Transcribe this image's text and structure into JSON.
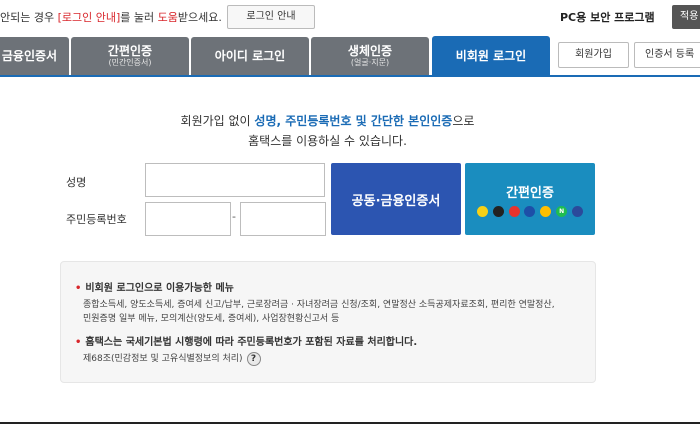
{
  "topbar": {
    "notice_pre": "안되는 경우 ",
    "notice_red1": "[로그인 안내]",
    "notice_mid": "를 눌러 ",
    "notice_red2": "도움",
    "notice_post": "받으세요.",
    "login_guide_label": "로그인 안내",
    "pc_security_label": "PC용 보안 프로그램",
    "apply_label": "적용"
  },
  "tabs": [
    {
      "label": "금융인증서",
      "sub": ""
    },
    {
      "label": "간편인증",
      "sub": "(민간인증서)"
    },
    {
      "label": "아이디 로그인",
      "sub": ""
    },
    {
      "label": "생체인증",
      "sub": "(얼굴·지문)"
    },
    {
      "label": "비회원 로그인",
      "sub": ""
    }
  ],
  "side_buttons": {
    "signup": "회원가입",
    "cert_register": "인증서 등록"
  },
  "intro": {
    "line1_pre": "회원가입 없이 ",
    "line1_blue": "성명, 주민등록번호 및 간단한 본인인증",
    "line1_post": "으로",
    "line2": "홈택스를 이용하실 수 있습니다."
  },
  "form": {
    "name_label": "성명",
    "rrn_label": "주민등록번호",
    "name_value": "",
    "rrn_front_value": "",
    "rrn_back_value": "",
    "dash": "-"
  },
  "buttons": {
    "joint_cert": "공동·금융인증서",
    "easy_auth": "간편인증"
  },
  "providers": [
    {
      "name": "kakao-icon",
      "text": "",
      "color": "#f7d117"
    },
    {
      "name": "payco-icon",
      "text": "",
      "color": "#222222"
    },
    {
      "name": "pass-icon",
      "text": "",
      "color": "#e8322d"
    },
    {
      "name": "samsung-icon",
      "text": "",
      "color": "#1d4fa8"
    },
    {
      "name": "kb-icon",
      "text": "",
      "color": "#ffbf00"
    },
    {
      "name": "naver-icon",
      "text": "N",
      "color": "#1fbd51"
    },
    {
      "name": "toss-icon",
      "text": "",
      "color": "#2b4a9b"
    }
  ],
  "info": {
    "title1": "비회원 로그인으로 이용가능한 메뉴",
    "line1": "종합소득세, 양도소득세, 증여세 신고/납부, 근로장려금 · 자녀장려금 신청/조회, 연말정산 소득공제자료조회, 편리한 연말정산,",
    "line2": "민원증명 일부 메뉴, 모의계산(양도세, 증여세), 사업장현황신고서 등",
    "title2_pre": "홈택스",
    "title2_post": "는 국세기본법 시행령에 따라 주민등록번호가 포함된 자료를 처리합니다.",
    "line3": "제68조(민감정보 및 고유식별정보의 처리)",
    "help_icon": "?"
  }
}
